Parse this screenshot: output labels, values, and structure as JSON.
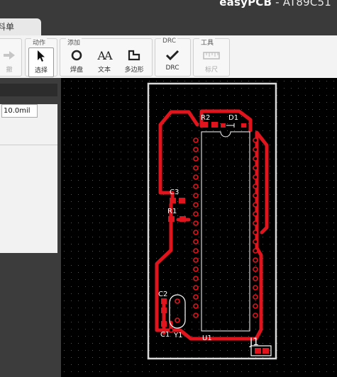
{
  "window": {
    "title_bold": "easyPCB",
    "title_rest": " - AT89C51"
  },
  "tab": {
    "label": "料单"
  },
  "toolbar": {
    "groups": [
      {
        "label": "动作"
      },
      {
        "label": "添加"
      },
      {
        "label": "DRC"
      },
      {
        "label": "工具"
      }
    ],
    "tools": {
      "cut_label": "撤",
      "select_label": "选择",
      "pad_label": "焊盘",
      "text_label": "文本",
      "polygon_label": "多边形",
      "drc_label": "DRC",
      "ruler_label": "标尺",
      "text_icon_glyph": "AA"
    }
  },
  "properties": {
    "grid_value": "10.0mil"
  },
  "pcb": {
    "labels": {
      "r2": "R2",
      "d1": "D1",
      "c3": "C3",
      "r1": "R1",
      "c2": "C2",
      "c1": "C1",
      "y1": "Y1",
      "u1": "U1",
      "j1": "J1"
    },
    "colors": {
      "trace": "#e0141c",
      "board": "#d9d9d9",
      "silk": "#ffffff",
      "pad_hole": "#000000"
    }
  }
}
